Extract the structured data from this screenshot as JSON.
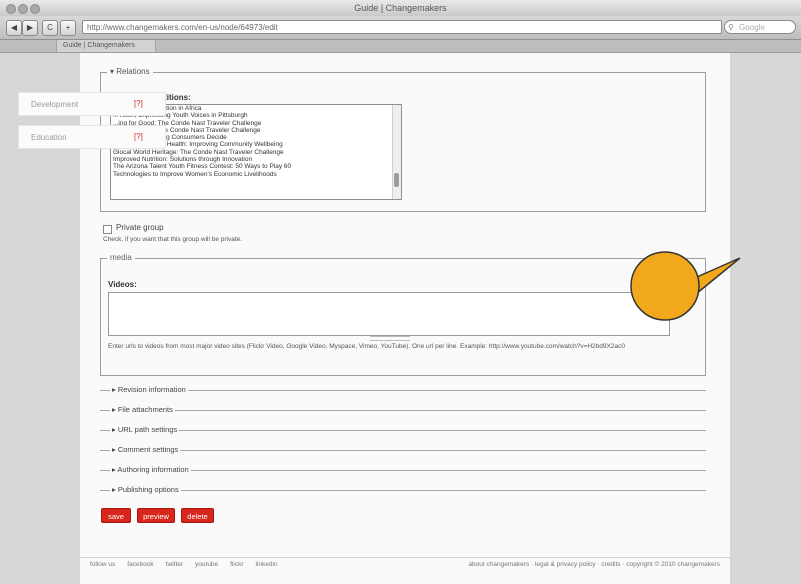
{
  "window": {
    "title": "Guide | Changemakers"
  },
  "toolbar": {
    "url": "http://www.changemakers.com/en-us/node/64973/edit",
    "search_placeholder": "Google",
    "back_label": "◀",
    "forward_label": "▶",
    "reload_label": "C",
    "add_label": "+"
  },
  "tabs": [
    {
      "label": "Guide | Changemakers"
    }
  ],
  "side_menu": [
    {
      "label": "Development",
      "flag": "[?]"
    },
    {
      "label": "Education",
      "flag": "[?]"
    }
  ],
  "relations": {
    "legend": "▾ Relations",
    "competitions_label": "Competitions:",
    "options": [
      "...of Quality Education in Africa",
      "...Youth, Expressing Youth Voices in Pittsburgh",
      "...ing for Good: The Conde Nast Traveler Challenge",
      "...to the World: The Conde Nast Traveler Challenge",
      "...: Rescue! Helping Consumers Decide",
      "Rethinking Mental Health: Improving Community Wellbeing",
      "Glocal World Heritage: The Conde Nast Traveler Challenge",
      "Improved Nutrition: Solutions through Innovation",
      "The Arizona Talent Youth Fitness Contest: 50 Ways to Play 60",
      "Technologies to Improve Women's Economic Livelihoods"
    ]
  },
  "private_group": {
    "label": "Private group",
    "help": "Check, if you want that this group will be private."
  },
  "media": {
    "legend": "media",
    "videos_label": "Videos:",
    "videos_value": "",
    "help": "Enter urls to videos from most major video sites (Flickr Video, Google Video, Myspace, Vimeo, YouTube). One url per line. Example: http://www.youtube.com/watch?v=H2bd9X2ac0"
  },
  "collapsed_sections": [
    "▸ Revision information",
    "▸ File attachments",
    "▸ URL path settings",
    "▸ Comment settings",
    "▸ Authoring information",
    "▸ Publishing options"
  ],
  "buttons": {
    "save": "save",
    "preview": "preview",
    "delete": "delete"
  },
  "footer": {
    "left_links": [
      "follow us",
      "facebook",
      "twitter",
      "youtube",
      "flickr",
      "linkedin"
    ],
    "right_text": "about changemakers  ·  legal & privacy policy  ·  credits  ·  copyright © 2010 changemakers"
  },
  "colors": {
    "accent": "#d9261c",
    "callout": "#f2a81d"
  }
}
